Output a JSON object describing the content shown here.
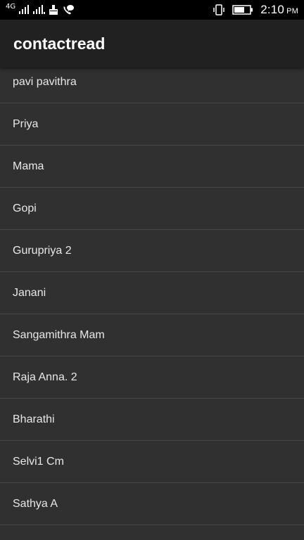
{
  "status_bar": {
    "network_label": "4G",
    "time": "2:10",
    "ampm": "PM"
  },
  "app_bar": {
    "title": "contactread"
  },
  "contacts": [
    "pavi pavithra",
    "Priya",
    "Mama",
    "Gopi",
    "Gurupriya 2",
    "Janani",
    "Sangamithra Mam",
    "Raja Anna. 2",
    "Bharathi",
    "Selvi1 Cm",
    "Sathya A"
  ]
}
